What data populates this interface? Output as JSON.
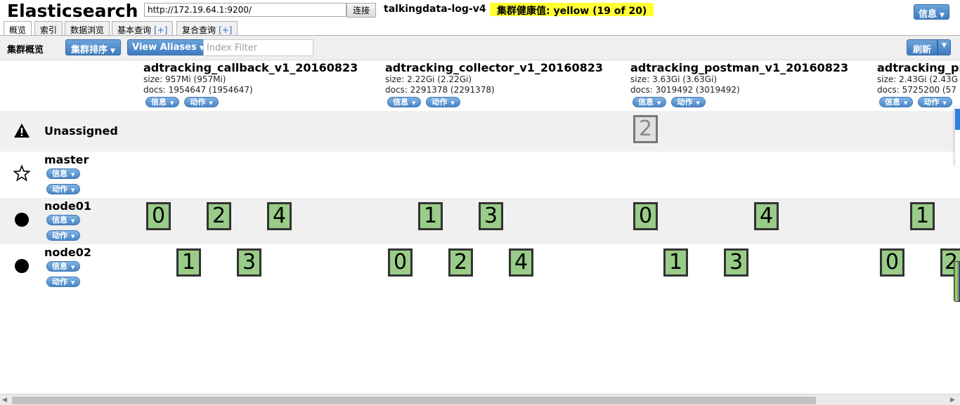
{
  "header": {
    "app_title": "Elasticsearch",
    "url_value": "http://172.19.64.1:9200/",
    "connect_label": "连接",
    "cluster_name": "talkingdata-log-v4",
    "health_text": "集群健康值: yellow (19 of 20)",
    "health_color": "#ffff33",
    "info_label": "信息"
  },
  "tabs": [
    {
      "label": "概览",
      "active": true
    },
    {
      "label": "索引",
      "active": false
    },
    {
      "label": "数据浏览",
      "active": false
    },
    {
      "label": "基本查询",
      "plus": "[+]",
      "active": false
    },
    {
      "label": "复合查询",
      "plus": "[+]",
      "active": false
    }
  ],
  "toolbar": {
    "title": "集群概览",
    "sort_label": "集群排序",
    "aliases_label": "View Aliases",
    "filter_placeholder": "Index Filter",
    "refresh_label": "刷新"
  },
  "mini_labels": {
    "info": "信息",
    "action": "动作"
  },
  "indices": [
    {
      "name": "adtracking_callback_v1_20160823",
      "size": "size: 957Mi (957Mi)",
      "docs": "docs: 1954647 (1954647)"
    },
    {
      "name": "adtracking_collector_v1_20160823",
      "size": "size: 2.22Gi (2.22Gi)",
      "docs": "docs: 2291378 (2291378)"
    },
    {
      "name": "adtracking_postman_v1_20160823",
      "size": "size: 3.63Gi (3.63Gi)",
      "docs": "docs: 3019492 (3019492)"
    },
    {
      "name": "adtracking_pr",
      "size": "size: 2.43Gi (2.43G",
      "docs": "docs: 5725200 (57"
    }
  ],
  "nodes": [
    {
      "name": "Unassigned",
      "icon": "warning-icon"
    },
    {
      "name": "master",
      "icon": "star-icon"
    },
    {
      "name": "node01",
      "icon": "node-dot-icon"
    },
    {
      "name": "node02",
      "icon": "node-dot-icon"
    }
  ],
  "shards": {
    "unassigned": [
      "2"
    ],
    "node01": [
      "0",
      "2",
      "4",
      "1",
      "3",
      "0",
      "4",
      "1"
    ],
    "node02": [
      "1",
      "3",
      "0",
      "2",
      "4",
      "1",
      "3",
      "0",
      "2"
    ]
  },
  "colors": {
    "shard_started": "#99cc88",
    "shard_unassigned": "#e0e0e0",
    "button_blue": "#4a86c8"
  }
}
